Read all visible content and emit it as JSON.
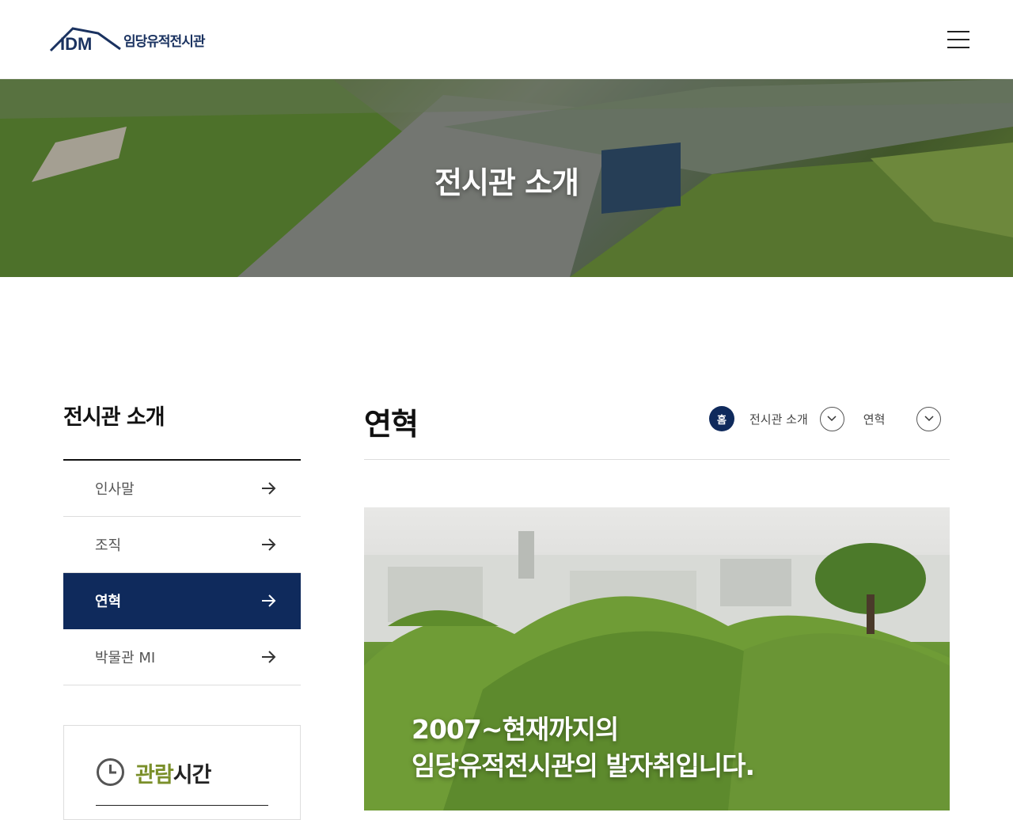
{
  "header": {
    "logo_text": "임당유적전시관",
    "logo_mark_letters": "IDM"
  },
  "hero": {
    "title": "전시관 소개"
  },
  "sidebar": {
    "title": "전시관 소개",
    "items": [
      {
        "label": "인사말",
        "active": false
      },
      {
        "label": "조직",
        "active": false
      },
      {
        "label": "연혁",
        "active": true
      },
      {
        "label": "박물관 MI",
        "active": false
      }
    ],
    "hours": {
      "title_accent": "관람",
      "title_rest": "시간"
    }
  },
  "main": {
    "title": "연혁",
    "breadcrumb": {
      "home": "홈",
      "level1": "전시관 소개",
      "level2": "연혁"
    },
    "feature": {
      "line1": "2007~현재까지의",
      "line2": "임당유적전시관의 발자취입니다."
    }
  },
  "colors": {
    "brand_navy": "#0f2a5c",
    "accent_olive": "#7a8f2a"
  }
}
